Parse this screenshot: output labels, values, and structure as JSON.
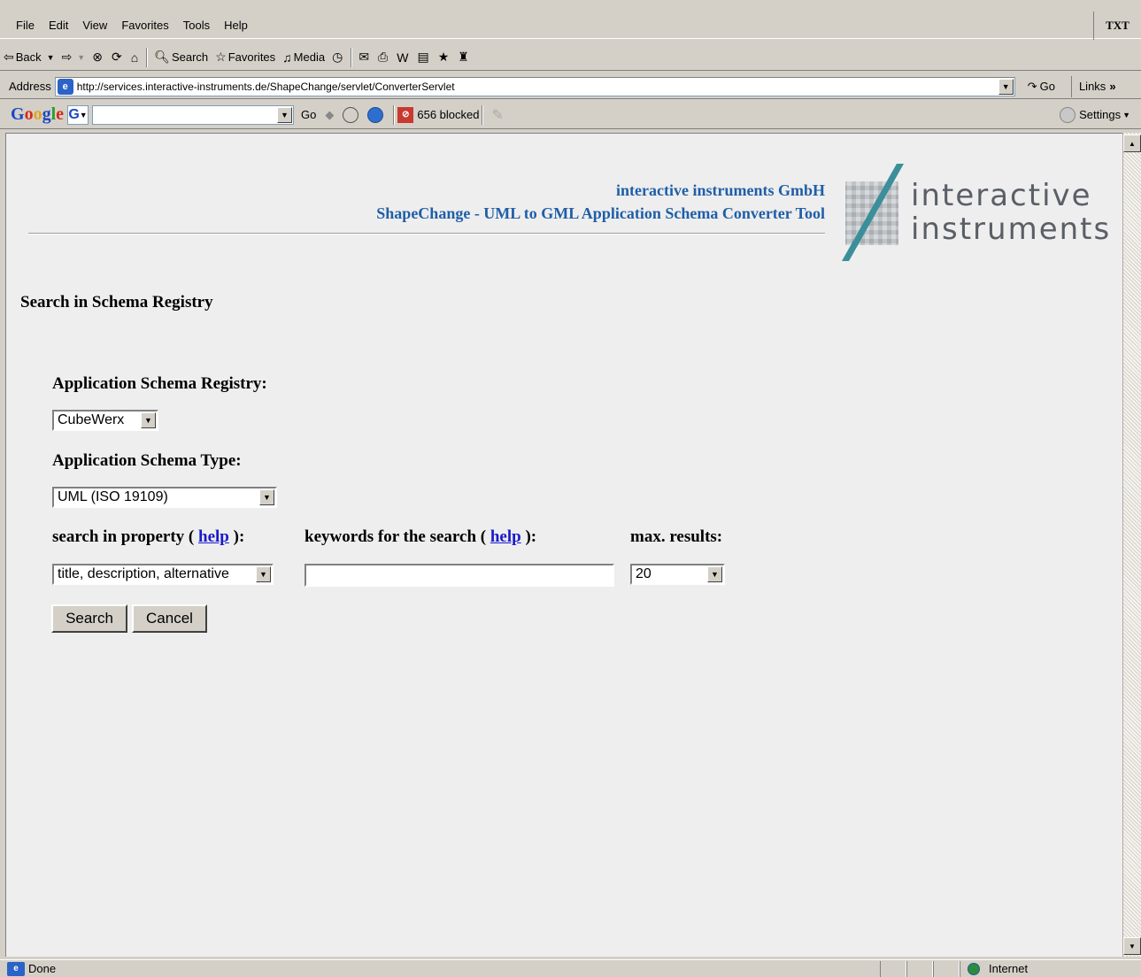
{
  "menu": {
    "items": [
      "File",
      "Edit",
      "View",
      "Favorites",
      "Tools",
      "Help"
    ],
    "right_logo": "TXT"
  },
  "toolbar": {
    "back": "Back",
    "search": "Search",
    "favorites": "Favorites",
    "media": "Media"
  },
  "address": {
    "label": "Address",
    "url": "http://services.interactive-instruments.de/ShapeChange/servlet/ConverterServlet",
    "go": "Go",
    "links": "Links"
  },
  "google": {
    "logo": [
      "G",
      "o",
      "o",
      "g",
      "l",
      "e"
    ],
    "go": "Go",
    "blocked": "656 blocked",
    "settings": "Settings"
  },
  "page": {
    "company": "interactive instruments GmbH",
    "tool_title": "ShapeChange - UML to GML Application Schema Converter Tool",
    "logo_line1": "interactive",
    "logo_line2": "instruments",
    "heading": "Search in Schema Registry",
    "registry_label": "Application Schema Registry:",
    "registry_value": "CubeWerx",
    "type_label": "Application Schema Type:",
    "type_value": "UML (ISO 19109)",
    "property_label_pre": "search in property (",
    "property_help": "help",
    "property_label_post": "):",
    "property_value": "title, description, alternative",
    "keywords_label_pre": "keywords for the search (",
    "keywords_help": "help",
    "keywords_label_post": "):",
    "keywords_value": "",
    "max_label": "max. results:",
    "max_value": "20",
    "search_button": "Search",
    "cancel_button": "Cancel"
  },
  "status": {
    "text": "Done",
    "zone": "Internet"
  },
  "colors": {
    "header_blue": "#1f5ea8",
    "link_blue": "#1a1acc",
    "logo_teal": "#3a8f9a",
    "logo_gray": "#5a5f66"
  }
}
